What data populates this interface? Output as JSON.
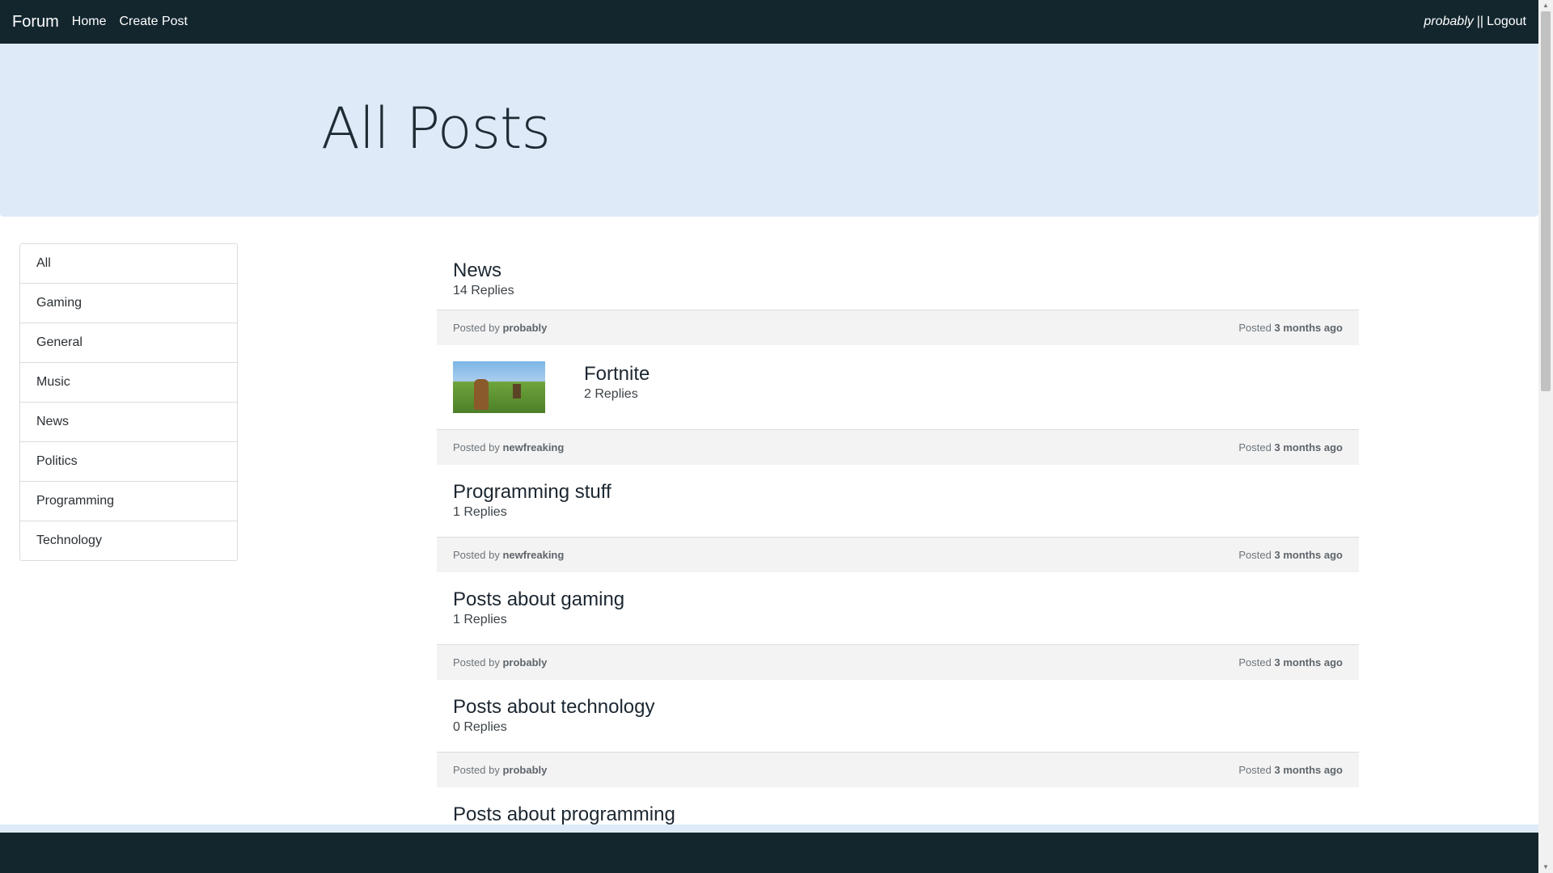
{
  "navbar": {
    "brand": "Forum",
    "links": [
      "Home",
      "Create Post"
    ],
    "user": "probably",
    "separator": "||",
    "logout": "Logout"
  },
  "hero": {
    "title": "All Posts"
  },
  "sidebar": {
    "categories": [
      "All",
      "Gaming",
      "General",
      "Music",
      "News",
      "Politics",
      "Programming",
      "Technology"
    ]
  },
  "posts": [
    {
      "title": "News",
      "replies": "14 Replies",
      "posted_by_label": "Posted by",
      "author": "probably",
      "posted_label": "Posted",
      "time": "3 months ago",
      "has_thumb": false
    },
    {
      "title": "Fortnite",
      "replies": "2 Replies",
      "posted_by_label": "Posted by",
      "author": "newfreaking",
      "posted_label": "Posted",
      "time": "3 months ago",
      "has_thumb": true
    },
    {
      "title": "Programming stuff",
      "replies": "1 Replies",
      "posted_by_label": "Posted by",
      "author": "newfreaking",
      "posted_label": "Posted",
      "time": "3 months ago",
      "has_thumb": false
    },
    {
      "title": "Posts about gaming",
      "replies": "1 Replies",
      "posted_by_label": "Posted by",
      "author": "probably",
      "posted_label": "Posted",
      "time": "3 months ago",
      "has_thumb": false
    },
    {
      "title": "Posts about technology",
      "replies": "0 Replies",
      "posted_by_label": "Posted by",
      "author": "probably",
      "posted_label": "Posted",
      "time": "3 months ago",
      "has_thumb": false
    },
    {
      "title": "Posts about programming"
    }
  ],
  "colors": {
    "navbar": "#13262e",
    "hero": "#dfeaf8",
    "footer_bar": "#f3f3f3"
  }
}
